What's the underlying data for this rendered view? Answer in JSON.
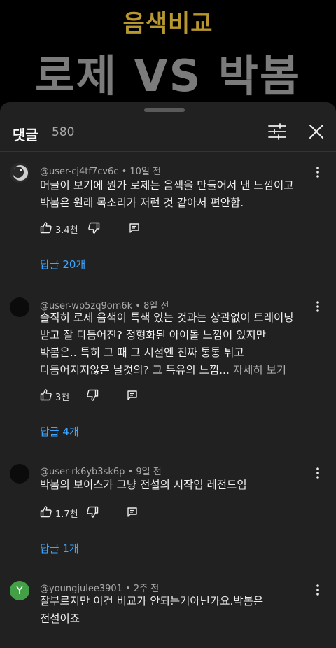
{
  "video": {
    "subtitle": "음색비교",
    "title": "로제 VS 박봄"
  },
  "comments_panel": {
    "title": "댓글",
    "count": "580"
  },
  "comments": [
    {
      "author": "@user-cj4tf7cv6c",
      "time": "10일 전",
      "lines": [
        "머글이 보기에 뭔가 로제는 음색을 만들어서 낸 느낌이고",
        "박봄은 원래 목소리가 저런 것 같아서 편안함."
      ],
      "likes": "3.4천",
      "replies": "답글 20개"
    },
    {
      "author": "@user-wp5zq9om6k",
      "time": "8일 전",
      "lines": [
        "솔직히 로제 음색이 특색 있는 것과는 상관없이 트레이닝",
        "받고 잘 다듬어진? 정형화된 아이돌 느낌이 있지만",
        "박봄은.. 특히 그 때 그 시절엔 진짜 통통 튀고",
        "다듬어지지않은 날것의? 그 특유의 느낌..."
      ],
      "see_more": "자세히 보기",
      "likes": "3천",
      "replies": "답글 4개"
    },
    {
      "author": "@user-rk6yb3sk6p",
      "time": "9일 전",
      "lines": [
        "박봄의 보이스가 그냥 전설의 시작임 레전드임"
      ],
      "likes": "1.7천",
      "replies": "답글 1개"
    },
    {
      "author": "@youngjulee3901",
      "time": "2주 전",
      "avatar_letter": "Y",
      "lines": [
        "잘부르지만 이건 비교가 안되는거아닌가요.박봄은",
        "전설이죠"
      ]
    }
  ],
  "colors": {
    "accent_link": "#3ea6ff",
    "avatar_green": "#43a047",
    "title_gold": "#b8982e"
  }
}
